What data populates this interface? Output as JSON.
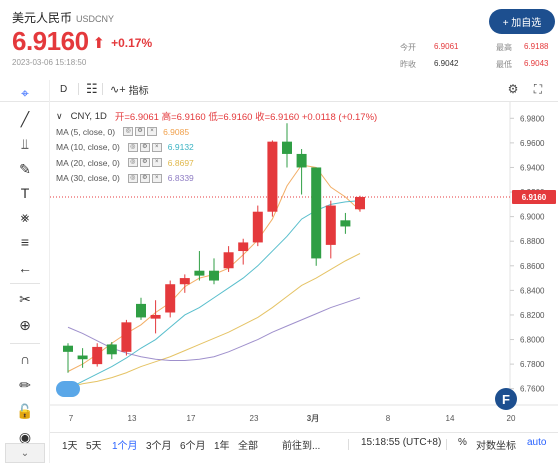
{
  "header": {
    "name": "美元人民币",
    "code": "USDCNY",
    "price": "6.9160",
    "change": "+0.17%",
    "timestamp": "2023-03-06 15:18:50",
    "add_button": "+ 加自选",
    "stats": {
      "open_label": "今开",
      "open": "6.9061",
      "prev_label": "昨收",
      "prev": "6.9042",
      "high_label": "最高",
      "high": "6.9188",
      "low_label": "最低",
      "low": "6.9043"
    }
  },
  "toolbar": {
    "interval": "D",
    "indicators": "指标"
  },
  "legend": {
    "symbol": "CNY, 1D",
    "ohlc": "开=6.9061  高=6.9160  低=6.9160  收=6.9160  +0.0118 (+0.17%)",
    "ma": [
      {
        "label": "MA (5, close, 0)",
        "value": "6.9085",
        "color": "#f0a04b"
      },
      {
        "label": "MA (10, close, 0)",
        "value": "6.9132",
        "color": "#3bb3c3"
      },
      {
        "label": "MA (20, close, 0)",
        "value": "6.8697",
        "color": "#e0b84a"
      },
      {
        "label": "MA (30, close, 0)",
        "value": "6.8339",
        "color": "#8e7cc3"
      }
    ]
  },
  "chart_data": {
    "type": "candlestick",
    "y_ticks": [
      "6.9800",
      "6.9600",
      "6.9400",
      "6.9200",
      "6.9000",
      "6.8800",
      "6.8600",
      "6.8400",
      "6.8200",
      "6.8000",
      "6.7800",
      "6.7600"
    ],
    "x_ticks": [
      "7",
      "13",
      "17",
      "23",
      "3月",
      "8",
      "14",
      "20"
    ],
    "ylim": [
      6.75,
      6.99
    ],
    "last_price_label": "6.9160",
    "candles": [
      {
        "o": 6.795,
        "h": 6.797,
        "l": 6.773,
        "c": 6.79
      },
      {
        "o": 6.787,
        "h": 6.793,
        "l": 6.777,
        "c": 6.784
      },
      {
        "o": 6.78,
        "h": 6.797,
        "l": 6.778,
        "c": 6.794
      },
      {
        "o": 6.796,
        "h": 6.798,
        "l": 6.784,
        "c": 6.788
      },
      {
        "o": 6.79,
        "h": 6.816,
        "l": 6.787,
        "c": 6.814
      },
      {
        "o": 6.829,
        "h": 6.834,
        "l": 6.816,
        "c": 6.818
      },
      {
        "o": 6.817,
        "h": 6.832,
        "l": 6.805,
        "c": 6.82
      },
      {
        "o": 6.822,
        "h": 6.848,
        "l": 6.818,
        "c": 6.845
      },
      {
        "o": 6.845,
        "h": 6.853,
        "l": 6.838,
        "c": 6.85
      },
      {
        "o": 6.856,
        "h": 6.872,
        "l": 6.848,
        "c": 6.852
      },
      {
        "o": 6.856,
        "h": 6.866,
        "l": 6.845,
        "c": 6.848
      },
      {
        "o": 6.858,
        "h": 6.876,
        "l": 6.855,
        "c": 6.871
      },
      {
        "o": 6.872,
        "h": 6.882,
        "l": 6.861,
        "c": 6.879
      },
      {
        "o": 6.879,
        "h": 6.909,
        "l": 6.876,
        "c": 6.904
      },
      {
        "o": 6.904,
        "h": 6.962,
        "l": 6.9,
        "c": 6.961
      },
      {
        "o": 6.961,
        "h": 6.976,
        "l": 6.94,
        "c": 6.951
      },
      {
        "o": 6.951,
        "h": 6.955,
        "l": 6.918,
        "c": 6.94
      },
      {
        "o": 6.94,
        "h": 6.94,
        "l": 6.86,
        "c": 6.866
      },
      {
        "o": 6.877,
        "h": 6.913,
        "l": 6.866,
        "c": 6.909
      },
      {
        "o": 6.897,
        "h": 6.903,
        "l": 6.886,
        "c": 6.892
      },
      {
        "o": 6.906,
        "h": 6.917,
        "l": 6.904,
        "c": 6.916
      }
    ],
    "ma_lines": [
      {
        "name": "MA5",
        "color": "#f0a04b",
        "values": [
          6.774,
          6.78,
          6.788,
          6.797,
          6.805,
          6.812,
          6.822,
          6.83,
          6.843,
          6.85,
          6.853,
          6.858,
          6.869,
          6.881,
          6.898,
          6.925,
          6.942,
          6.94,
          6.924,
          6.916,
          6.905
        ]
      },
      {
        "name": "MA10",
        "color": "#3bb3c3",
        "values": [
          6.76,
          6.766,
          6.772,
          6.778,
          6.785,
          6.793,
          6.8,
          6.81,
          6.82,
          6.826,
          6.834,
          6.842,
          6.85,
          6.86,
          6.872,
          6.884,
          6.898,
          6.905,
          6.91,
          6.912,
          6.913
        ]
      },
      {
        "name": "MA20",
        "color": "#e0b84a",
        "values": [
          6.761,
          6.764,
          6.766,
          6.769,
          6.773,
          6.778,
          6.782,
          6.786,
          6.791,
          6.796,
          6.801,
          6.806,
          6.812,
          6.818,
          6.826,
          6.835,
          6.844,
          6.85,
          6.857,
          6.864,
          6.87
        ]
      },
      {
        "name": "MA30",
        "color": "#8e7cc3",
        "values": [
          6.81,
          6.805,
          6.799,
          6.793,
          6.789,
          6.786,
          6.784,
          6.783,
          6.783,
          6.784,
          6.786,
          6.79,
          6.795,
          6.8,
          6.806,
          6.811,
          6.816,
          6.821,
          6.826,
          6.83,
          6.834
        ]
      }
    ]
  },
  "bottombar": {
    "ranges": [
      "1天",
      "5天",
      "1个月",
      "3个月",
      "6个月",
      "1年",
      "全部"
    ],
    "active": "1个月",
    "goto": "前往到...",
    "time": "15:18:55 (UTC+8)",
    "percent": "%",
    "log": "对数坐标",
    "auto": "auto"
  },
  "colors": {
    "up": "#e4393c",
    "down": "#2f9e44",
    "accent": "#2962ff",
    "brand": "#1d4f8f"
  }
}
